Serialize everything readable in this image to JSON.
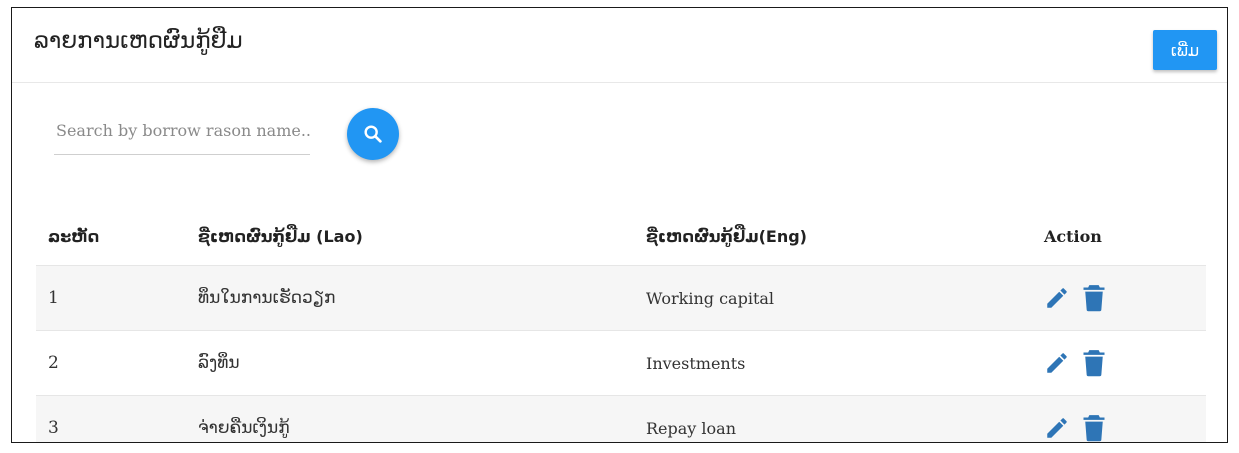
{
  "header": {
    "title": "ລາຍການເຫດຜົນກູ້ຢືມ",
    "add_button_label": "ເພີ່ມ"
  },
  "search": {
    "placeholder": "Search by borrow rason name...",
    "value": "",
    "button_icon": "search-icon"
  },
  "table": {
    "columns": [
      "ລະຫັດ",
      "ຊື່ເຫດຜົນກູ້ຢືມ (Lao)",
      "ຊື່ເຫດຜົນກູ້ຢືມ(Eng)",
      "Action"
    ],
    "rows": [
      {
        "id": "1",
        "lao": "ທຶນໃນການເຮັດວຽກ",
        "eng": "Working capital"
      },
      {
        "id": "2",
        "lao": "ລົງທຶນ",
        "eng": "Investments"
      },
      {
        "id": "3",
        "lao": "ຈ່າຍຄືນເງິນກູ້",
        "eng": "Repay loan"
      }
    ],
    "action_icons": [
      "edit-icon",
      "delete-icon"
    ]
  },
  "colors": {
    "primary": "#2196f3",
    "action_icon": "#2e75b6",
    "stripe": "#f6f6f6"
  }
}
